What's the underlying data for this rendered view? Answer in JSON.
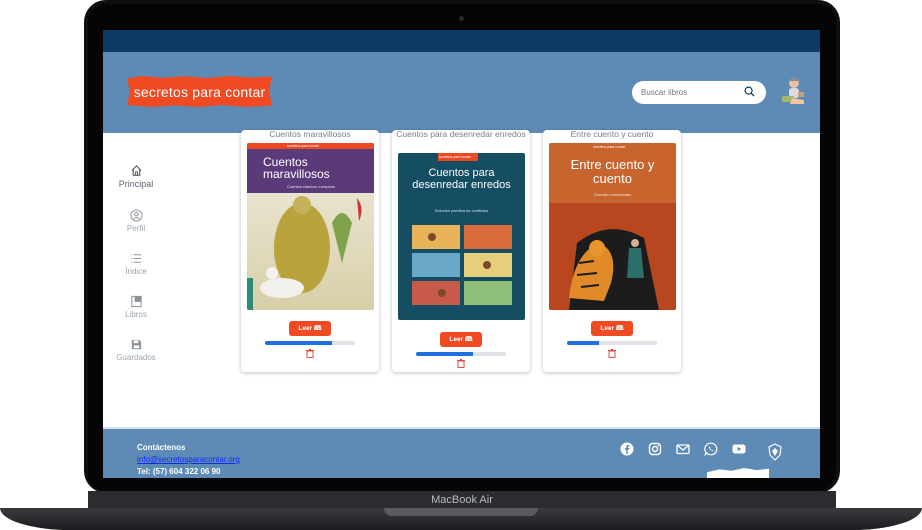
{
  "device": {
    "label": "MacBook Air"
  },
  "header": {
    "logo_text": "secretos para contar",
    "search_placeholder": "Buscar libros"
  },
  "sidebar": {
    "items": [
      {
        "label": "Principal",
        "icon": "home-icon",
        "active": true
      },
      {
        "label": "Perfil",
        "icon": "profile-icon",
        "active": false
      },
      {
        "label": "Índice",
        "icon": "list-icon",
        "active": false
      },
      {
        "label": "Libros",
        "icon": "book-icon",
        "active": false
      },
      {
        "label": "Guardados",
        "icon": "save-icon",
        "active": false
      }
    ]
  },
  "books": [
    {
      "title": "Cuentos maravillosos",
      "cover_title": "Cuentos maravillosos",
      "cover_subtitle": "Cuentos clásicos europeos",
      "series": "secretos para contar",
      "read_label": "Leer 🕮",
      "progress": 0.74
    },
    {
      "title": "Cuentos para desenredar enredos",
      "cover_title": "Cuentos para desenredar enredos",
      "cover_subtitle": "Solución pacífica de conflictos",
      "series": "secretos para contar",
      "read_label": "Leer 🕮",
      "progress": 0.63
    },
    {
      "title": "Entre cuento y cuento",
      "cover_title": "Entre cuento y cuento",
      "cover_subtitle": "Grandes narraciones",
      "series": "secretos para contar",
      "read_label": "Leer 🕮",
      "progress": 0.35
    }
  ],
  "footer": {
    "contact_title": "Contáctenos",
    "email": "info@secretosparacontar.org",
    "phone": "Tel: (57) 604 322 06 90",
    "social": [
      "facebook-icon",
      "instagram-icon",
      "mail-icon",
      "whatsapp-icon",
      "youtube-icon"
    ]
  },
  "colors": {
    "brand": "#f04a23",
    "header": "#5e8bb6",
    "topbar": "#0f3a63",
    "progress": "#1f6fe0"
  }
}
